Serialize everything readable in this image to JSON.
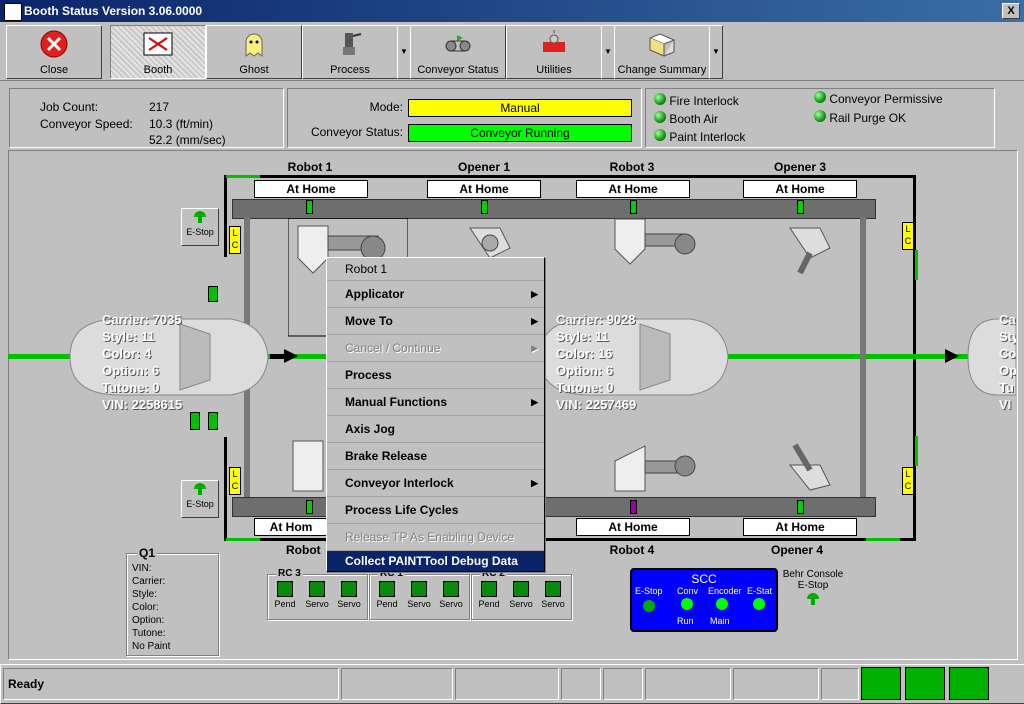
{
  "window": {
    "title": "Booth Status  Version 3.06.0000",
    "close_glyph": "X"
  },
  "toolbar": [
    {
      "label": "Close",
      "icon": "close-icon"
    },
    {
      "label": "Booth",
      "icon": "booth-icon"
    },
    {
      "label": "Ghost",
      "icon": "ghost-icon"
    },
    {
      "label": "Process",
      "icon": "process-icon"
    },
    {
      "label": "Conveyor Status",
      "icon": "conveyor-icon"
    },
    {
      "label": "Utilities",
      "icon": "utilities-icon"
    },
    {
      "label": "Change Summary",
      "icon": "change-summary-icon"
    }
  ],
  "job_info": {
    "job_count_label": "Job Count:",
    "job_count": "217",
    "speed_label": "Conveyor Speed:",
    "speed_ftmin": "10.3 (ft/min)",
    "speed_mmsec": "52.2 (mm/sec)"
  },
  "mode": {
    "mode_label": "Mode:",
    "mode_value": "Manual",
    "conv_label": "Conveyor Status:",
    "conv_value": "Conveyor Running"
  },
  "interlocks": {
    "left": [
      "Fire Interlock",
      "Booth Air",
      "Paint Interlock"
    ],
    "right": [
      "Conveyor Permissive",
      "Rail Purge OK"
    ]
  },
  "robots_top": [
    {
      "name": "Robot 1",
      "status": "At Home"
    },
    {
      "name": "Opener 1",
      "status": "At Home"
    },
    {
      "name": "Robot 3",
      "status": "At Home"
    },
    {
      "name": "Opener 3",
      "status": "At Home"
    }
  ],
  "robots_bottom": [
    {
      "name": "Robot",
      "status": "At Hom"
    },
    {
      "name": "",
      "status": ""
    },
    {
      "name": "Robot 4",
      "status": "At Home"
    },
    {
      "name": "Opener 4",
      "status": "At Home"
    }
  ],
  "estop_label": "E-Stop",
  "lc_label": "L\nC",
  "car_left": {
    "carrier": "Carrier: 7035",
    "style": "Style: 11",
    "color": "Color: 4",
    "option": "Option: 6",
    "tutone": "Tutone: 0",
    "vin": "VIN: 2258615"
  },
  "car_mid": {
    "carrier": "Carrier: 9028",
    "style": "Style: 11",
    "color": "Color: 16",
    "option": "Option: 6",
    "tutone": "Tutone: 0",
    "vin": "VIN: 2257469"
  },
  "car_right": [
    "Ca",
    "Sty",
    "Co",
    "Op",
    "Tu",
    "VI"
  ],
  "context_menu": {
    "header": "Robot 1",
    "items": [
      {
        "label": "Applicator",
        "submenu": true,
        "disabled": false
      },
      {
        "label": "Move To",
        "submenu": true,
        "disabled": false
      },
      {
        "label": "Cancel / Continue",
        "submenu": true,
        "disabled": true
      },
      {
        "label": "Process",
        "submenu": false,
        "disabled": false
      },
      {
        "label": "Manual Functions",
        "submenu": true,
        "disabled": false
      },
      {
        "label": "Axis Jog",
        "submenu": false,
        "disabled": false
      },
      {
        "label": "Brake Release",
        "submenu": false,
        "disabled": false
      },
      {
        "label": "Conveyor Interlock",
        "submenu": true,
        "disabled": false
      },
      {
        "label": "Process Life Cycles",
        "submenu": false,
        "disabled": false
      },
      {
        "label": "Release TP As Enabling Device",
        "submenu": false,
        "disabled": true
      },
      {
        "label": "Collect PAINTTool Debug Data",
        "submenu": false,
        "disabled": false,
        "selected": true
      }
    ]
  },
  "q1": {
    "title": "Q1",
    "lines": [
      "VIN:",
      "Carrier:",
      "Style:",
      "Color:",
      "Option:",
      "Tutone:",
      "No Paint"
    ]
  },
  "rc_groups": [
    {
      "title": "RC 3",
      "items": [
        "Pend",
        "Servo",
        "Servo"
      ]
    },
    {
      "title": "RC 1",
      "items": [
        "Pend",
        "Servo",
        "Servo"
      ]
    },
    {
      "title": "RC 2",
      "items": [
        "Pend",
        "Servo",
        "Servo"
      ]
    }
  ],
  "scc": {
    "title": "SCC",
    "top": [
      "E-Stop",
      "Conv",
      "Encoder",
      "E-Stat"
    ],
    "bottom": [
      "Run",
      "Main"
    ]
  },
  "behr_console": {
    "line1": "Behr Console",
    "line2": "E-Stop"
  },
  "status_bar": {
    "text": "Ready"
  },
  "colors": {
    "accent": "#0a246a",
    "mode_yellow": "#ffff00",
    "running_green": "#00ff00",
    "scc_blue": "#0000ff"
  }
}
